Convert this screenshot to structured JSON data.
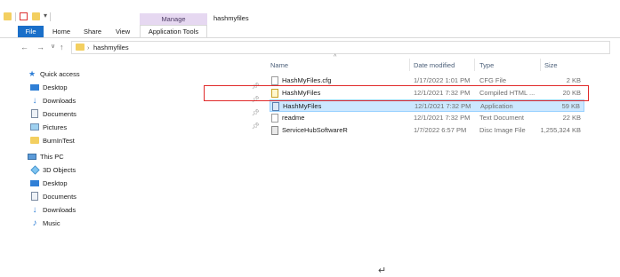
{
  "window": {
    "title": "hashmyfiles",
    "contextual_tab_group": "Manage"
  },
  "ribbon": {
    "tabs": [
      "File",
      "Home",
      "Share",
      "View",
      "Application Tools"
    ],
    "active_color": "#1a6fc9",
    "contextual_color": "#e6d8f1"
  },
  "address_bar": {
    "path_separator": "›",
    "path": "hashmyfiles"
  },
  "nav_pane": {
    "quick_access_label": "Quick access",
    "quick_access_items": [
      {
        "label": "Desktop",
        "icon": "desktop-icon",
        "pinned": true
      },
      {
        "label": "Downloads",
        "icon": "downloads-icon",
        "pinned": true
      },
      {
        "label": "Documents",
        "icon": "documents-icon",
        "pinned": true
      },
      {
        "label": "Pictures",
        "icon": "pictures-icon",
        "pinned": true
      },
      {
        "label": "BurnInTest",
        "icon": "folder-icon",
        "pinned": false
      }
    ],
    "this_pc_label": "This PC",
    "this_pc_items": [
      {
        "label": "3D Objects",
        "icon": "3d-objects-icon"
      },
      {
        "label": "Desktop",
        "icon": "desktop-icon"
      },
      {
        "label": "Documents",
        "icon": "documents-icon"
      },
      {
        "label": "Downloads",
        "icon": "downloads-icon"
      },
      {
        "label": "Music",
        "icon": "music-icon"
      }
    ]
  },
  "file_list": {
    "columns": [
      "Name",
      "Date modified",
      "Type",
      "Size"
    ],
    "sort_indicator": "^",
    "rows": [
      {
        "name": "HashMyFiles.cfg",
        "date": "1/17/2022 1:01 PM",
        "type": "CFG File",
        "size": "2 KB",
        "icon": "cfg-file-icon",
        "selected": false
      },
      {
        "name": "HashMyFiles",
        "date": "12/1/2021 7:32 PM",
        "type": "Compiled HTML ...",
        "size": "20 KB",
        "icon": "chm-file-icon",
        "selected": false
      },
      {
        "name": "HashMyFiles",
        "date": "12/1/2021 7:32 PM",
        "type": "Application",
        "size": "59 KB",
        "icon": "application-icon",
        "selected": true
      },
      {
        "name": "readme",
        "date": "12/1/2021 7:32 PM",
        "type": "Text Document",
        "size": "22 KB",
        "icon": "text-file-icon",
        "selected": false
      },
      {
        "name": "ServiceHubSoftwareR",
        "date": "1/7/2022 6:57 PM",
        "type": "Disc Image File",
        "size": "1,255,324 KB",
        "icon": "disc-image-icon",
        "selected": false
      }
    ]
  },
  "annotation": {
    "highlight_color": "#e02a2a"
  },
  "cursor_glyph": "↵"
}
